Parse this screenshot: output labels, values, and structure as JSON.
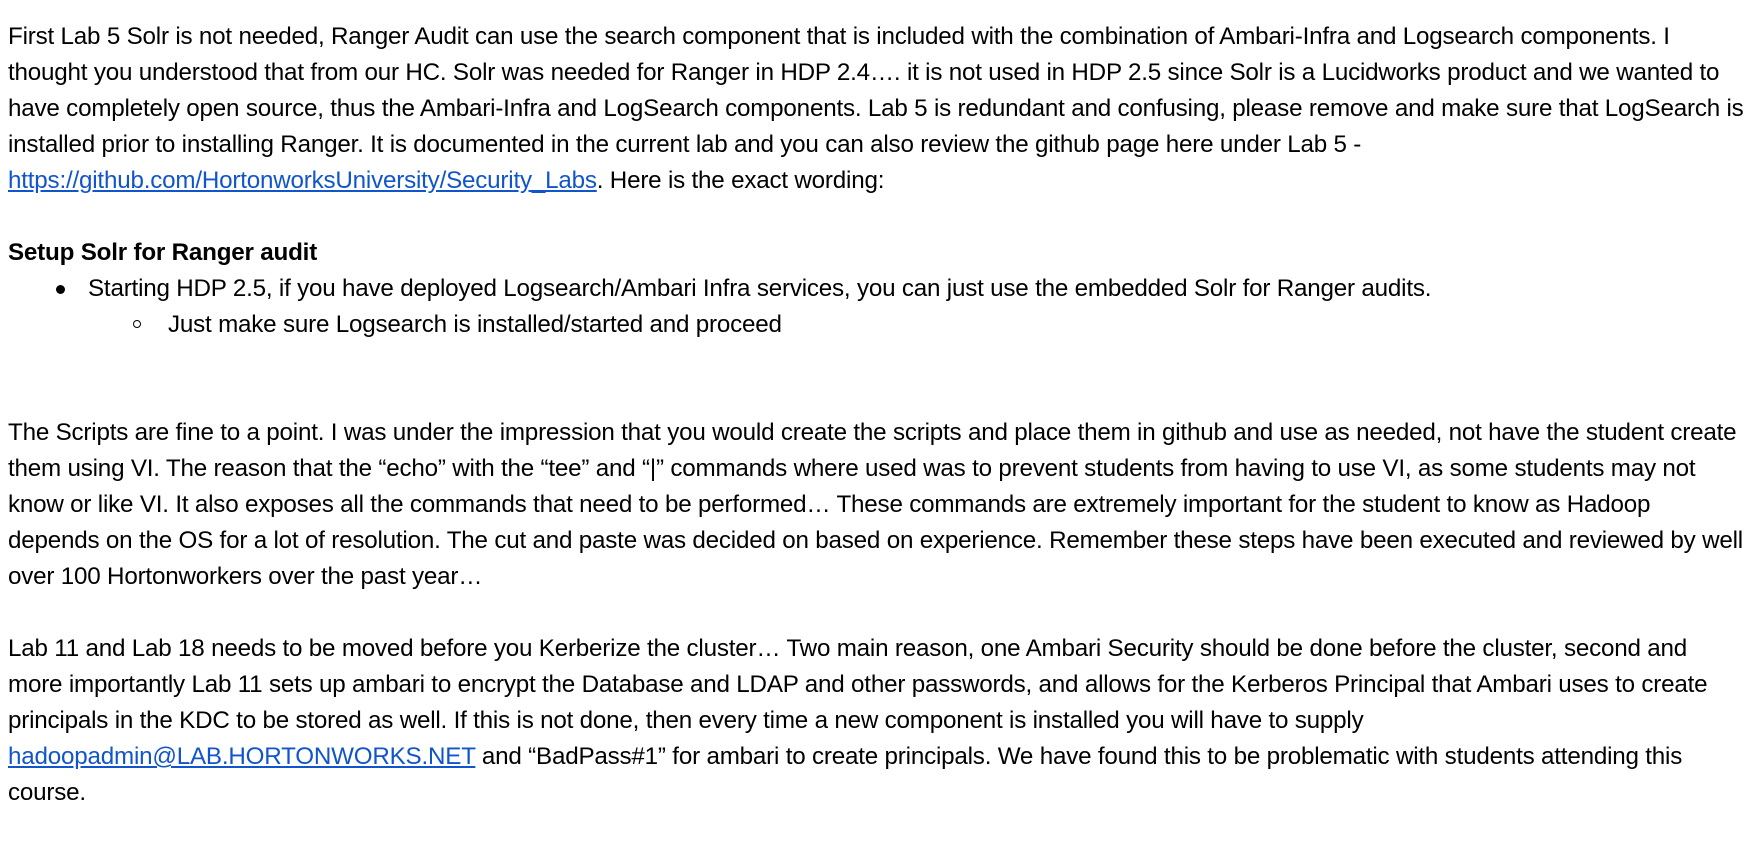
{
  "para1": {
    "text_before_link": "First Lab 5 Solr is not needed, Ranger Audit can use the search component that is included with the combination of Ambari-Infra and Logsearch components. I thought you understood that from our HC. Solr was needed for Ranger in HDP 2.4…. it is not used in HDP 2.5 since Solr is a Lucidworks product and we wanted to have completely open source, thus the Ambari-Infra and LogSearch components. Lab 5 is redundant and confusing, please remove and make sure that LogSearch is installed prior to installing Ranger. It is documented in the current lab and you can also review the github page here under Lab 5 -   ",
    "link_text": "https://github.com/HortonworksUniversity/Security_Labs",
    "text_after_link": ". Here is the exact wording:"
  },
  "section": {
    "heading": "Setup Solr for Ranger audit",
    "bullet": "Starting HDP 2.5, if you have deployed Logsearch/Ambari Infra services, you can just use the embedded Solr for Ranger audits.",
    "sub_bullet": "Just make sure Logsearch is installed/started and proceed"
  },
  "para2": {
    "text": "The Scripts are fine to a point. I was under the impression that you would create the scripts and place them in github and use as needed, not have the student create them using VI. The reason that the “echo” with the “tee” and “|” commands where used was to prevent students from having to use VI, as some students may not know or like VI. It also exposes all the commands that need to be performed… These commands are extremely important for the student to know as Hadoop depends on the OS for a lot of resolution.  The cut and paste was decided on based on experience. Remember these steps have been executed and reviewed by well over 100 Hortonworkers over the past year…"
  },
  "para3": {
    "text_before_link": "Lab 11 and Lab 18 needs to be moved before you Kerberize the cluster… Two main reason, one Ambari Security should be done before the cluster, second and more importantly Lab 11 sets up ambari to encrypt the Database and LDAP and other passwords, and allows for the Kerberos Principal that Ambari uses to create principals in the KDC to be stored as well. If this is not done, then every time a new component is installed you will have to supply ",
    "link_text": "hadoopadmin@LAB.HORTONWORKS.NET",
    "text_after_link": " and “BadPass#1” for ambari to create principals. We have found this to be problematic with students attending this course."
  },
  "colors": {
    "text": "#000000",
    "link": "#1155cc",
    "background": "#ffffff"
  }
}
